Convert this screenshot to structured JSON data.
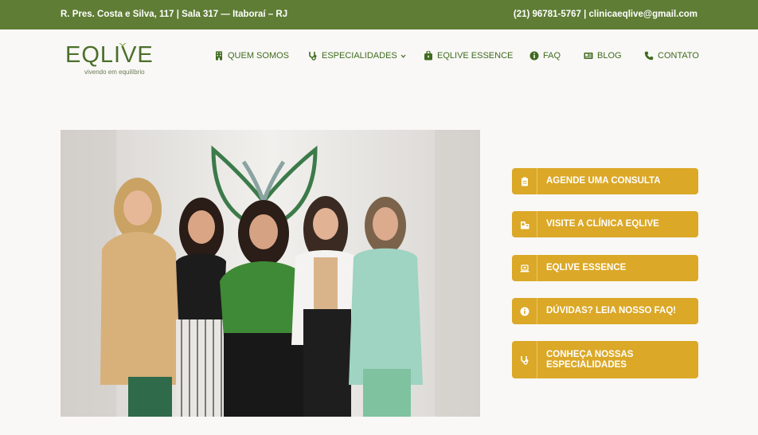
{
  "topbar": {
    "address": "R. Pres. Costa e Silva, 117 | Sala 317 — Itaboraí – RJ",
    "contact": "(21) 96781-5767 | clinicaeqlive@gmail.com"
  },
  "logo": {
    "wordmark": "EQLIVE",
    "tagline": "vivendo em equilíbrio"
  },
  "nav": {
    "items": [
      {
        "label": "QUEM SOMOS",
        "icon": "building-icon"
      },
      {
        "label": "ESPECIALIDADES",
        "icon": "stethoscope-icon",
        "dropdown": true
      },
      {
        "label": "EQLIVE ESSENCE",
        "icon": "bag-icon"
      },
      {
        "label": "FAQ",
        "icon": "info-icon"
      },
      {
        "label": "BLOG",
        "icon": "newspaper-icon"
      },
      {
        "label": "CONTATO",
        "icon": "phone-icon"
      }
    ]
  },
  "buttons": [
    {
      "label": "AGENDE UMA CONSULTA",
      "icon": "clipboard-icon"
    },
    {
      "label": "VISITE A CLÍNICA EQLIVE",
      "icon": "clinic-icon"
    },
    {
      "label": "EQLIVE ESSENCE",
      "icon": "laptop-icon"
    },
    {
      "label": "DÚVIDAS? LEIA NOSSO FAQ!",
      "icon": "info-icon"
    },
    {
      "label_line1": "CONHEÇA NOSSAS",
      "label_line2": "ESPECIALIDADES",
      "icon": "stethoscope-icon"
    }
  ],
  "colors": {
    "topbar": "#5f7d35",
    "brand_green": "#4c6f2b",
    "button_gold": "#dba827",
    "background": "#f9f8f6"
  }
}
